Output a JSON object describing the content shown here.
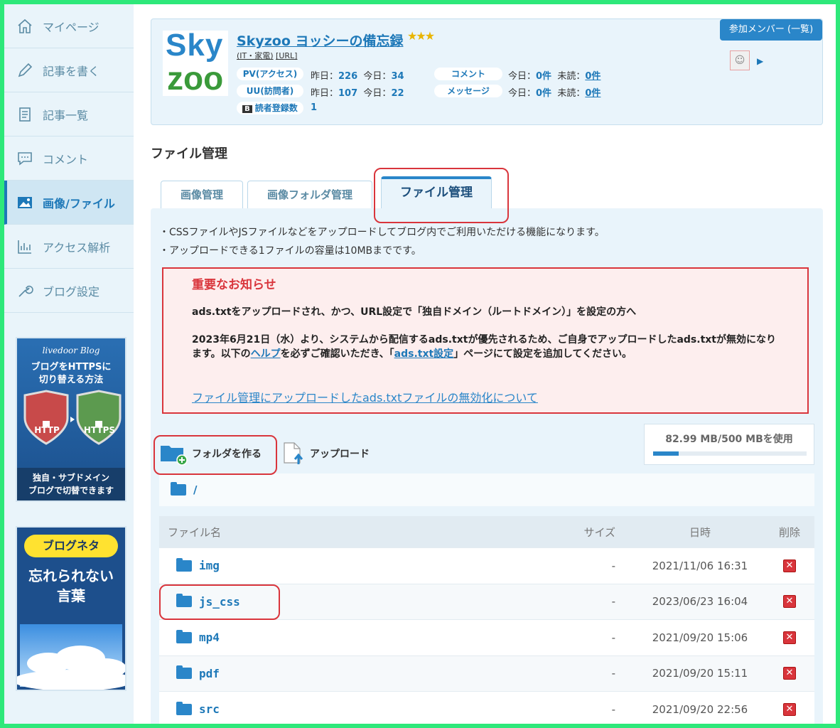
{
  "sidebar": {
    "items": [
      {
        "label": "マイページ"
      },
      {
        "label": "記事を書く"
      },
      {
        "label": "記事一覧"
      },
      {
        "label": "コメント"
      },
      {
        "label": "画像/ファイル"
      },
      {
        "label": "アクセス解析"
      },
      {
        "label": "ブログ設定"
      }
    ],
    "active_index": 4,
    "banner1": {
      "brand": "livedoor Blog",
      "title_l1": "ブログをHTTPSに",
      "title_l2": "切り替える方法",
      "badge_left": "HTTP",
      "badge_right": "HTTPS",
      "bottom_l1": "独自・サブドメイン",
      "bottom_l2": "ブログで切替できます"
    },
    "banner2": {
      "pill": "ブログネタ",
      "line1": "忘れられない",
      "line2": "言葉"
    }
  },
  "header": {
    "logo_top": "Sky",
    "logo_bottom": "zoo",
    "blog_title": "Skyzoo ヨッシーの備忘録",
    "stars": "★★★",
    "category": "(IT・家電)",
    "url_label": "[URL]",
    "pv_label": "PV(アクセス)",
    "pv_yesterday_label": "昨日：",
    "pv_yesterday": "226",
    "pv_today_label": "今日：",
    "pv_today": "34",
    "uu_label": "UU(訪問者)",
    "uu_yesterday_label": "昨日：",
    "uu_yesterday": "107",
    "uu_today_label": "今日：",
    "uu_today": "22",
    "reader_icon": "B",
    "reader_label": "読者登録数",
    "reader_count": "1",
    "comment_label": "コメント",
    "comment_today_label": "今日：",
    "comment_today": "0件",
    "comment_unread_label": "未読：",
    "comment_unread": "0件",
    "message_label": "メッセージ",
    "message_today_label": "今日：",
    "message_today": "0件",
    "message_unread_label": "未読：",
    "message_unread": "0件",
    "members_button": "参加メンバー (一覧)"
  },
  "page_title": "ファイル管理",
  "tabs": [
    {
      "label": "画像管理"
    },
    {
      "label": "画像フォルダ管理"
    },
    {
      "label": "ファイル管理"
    }
  ],
  "bullets": [
    "・CSSファイルやJSファイルなどをアップロードしてブログ内でご利用いただける機能になります。",
    "・アップロードできる1ファイルの容量は10MBまでです。"
  ],
  "notice": {
    "title": "重要なお知らせ",
    "line1": "ads.txtをアップロードされ、かつ、URL設定で「独自ドメイン（ルートドメイン）」を設定の方へ",
    "line2_a": "2023年6月21日（水）より、システムから配信するads.txtが優先されるため、ご自身でアップロードしたads.txtが無効になります。以下の",
    "line2_link1": "ヘルプ",
    "line2_b": "を必ずご確認いただき、「",
    "line2_link2": "ads.txt設定",
    "line2_c": "」ページにて設定を追加してください。",
    "link": "ファイル管理にアップロードしたads.txtファイルの無効化について"
  },
  "toolbar": {
    "new_folder": "フォルダを作る",
    "upload": "アップロード"
  },
  "usage": {
    "text": "82.99 MB/500 MBを使用",
    "fraction": 0.166
  },
  "path": "/",
  "table": {
    "headers": {
      "name": "ファイル名",
      "size": "サイズ",
      "date": "日時",
      "delete": "削除"
    },
    "rows": [
      {
        "name": "img",
        "size": "-",
        "date": "2021/11/06 16:31"
      },
      {
        "name": "js_css",
        "size": "-",
        "date": "2023/06/23 16:04"
      },
      {
        "name": "mp4",
        "size": "-",
        "date": "2021/09/20 15:06"
      },
      {
        "name": "pdf",
        "size": "-",
        "date": "2021/09/20 15:11"
      },
      {
        "name": "src",
        "size": "-",
        "date": "2021/09/20 22:56"
      }
    ]
  },
  "colors": {
    "accent": "#1d78b8",
    "alert": "#d9353c",
    "frame": "#2ee87a"
  }
}
